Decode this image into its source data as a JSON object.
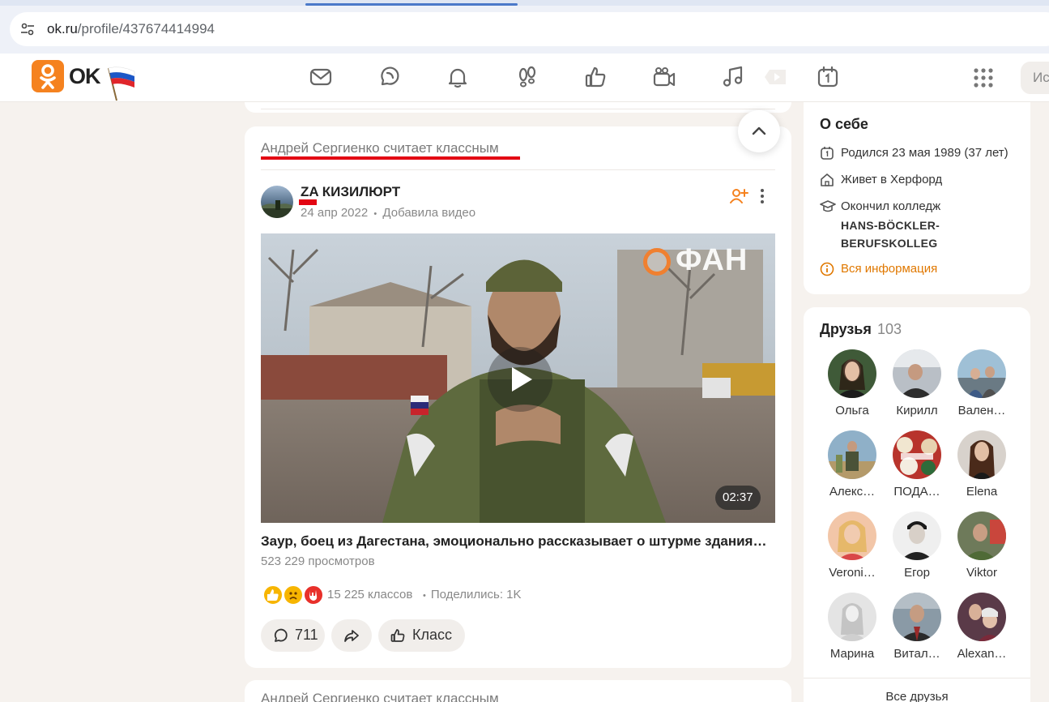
{
  "browser": {
    "url_host": "ok.ru",
    "url_path": "/profile/437674414994"
  },
  "header": {
    "logo_text": "OK",
    "search_placeholder": "Ис"
  },
  "feed": {
    "activity_label": "Андрей Сергиенко считает классным",
    "post": {
      "group_name": "ZA КИЗИЛЮРТ",
      "date": "24 апр 2022",
      "meta_separator": "•",
      "action": "Добавила видео",
      "video_watermark": "ФАН",
      "video_duration": "02:37",
      "video_title": "Заур, боец из Дагестана, эмоционально рассказывает о штурме здания…",
      "views": "523 229 просмотров",
      "class_count": "15 225 классов",
      "stat_separator": "•",
      "shared": "Поделились: 1K",
      "comments_count": "711",
      "class_button": "Класс"
    },
    "next_activity_label": "Андрей Сергиенко считает классным"
  },
  "about": {
    "title": "О себе",
    "born": "Родился 23 мая 1989 (37 лет)",
    "lives": "Живет в Херфорд",
    "education_prefix": "Окончил колледж",
    "school_line1": "HANS-BÖCKLER-",
    "school_line2": "BERUFSKOLLEG",
    "all_info": "Вся информация"
  },
  "friends": {
    "title": "Друзья",
    "count": "103",
    "list": [
      {
        "name": "Ольга"
      },
      {
        "name": "Кирилл"
      },
      {
        "name": "Вален…"
      },
      {
        "name": "Алекс…"
      },
      {
        "name": "ПОДА…"
      },
      {
        "name": "Elena"
      },
      {
        "name": "Veroni…"
      },
      {
        "name": "Егор"
      },
      {
        "name": "Viktor"
      },
      {
        "name": "Марина"
      },
      {
        "name": "Витал…"
      },
      {
        "name": "Alexan…"
      }
    ],
    "all_link": "Все друзья"
  },
  "colors": {
    "brand": "#f5821f",
    "highlight_red": "#e30613",
    "info_link": "#e07800"
  }
}
